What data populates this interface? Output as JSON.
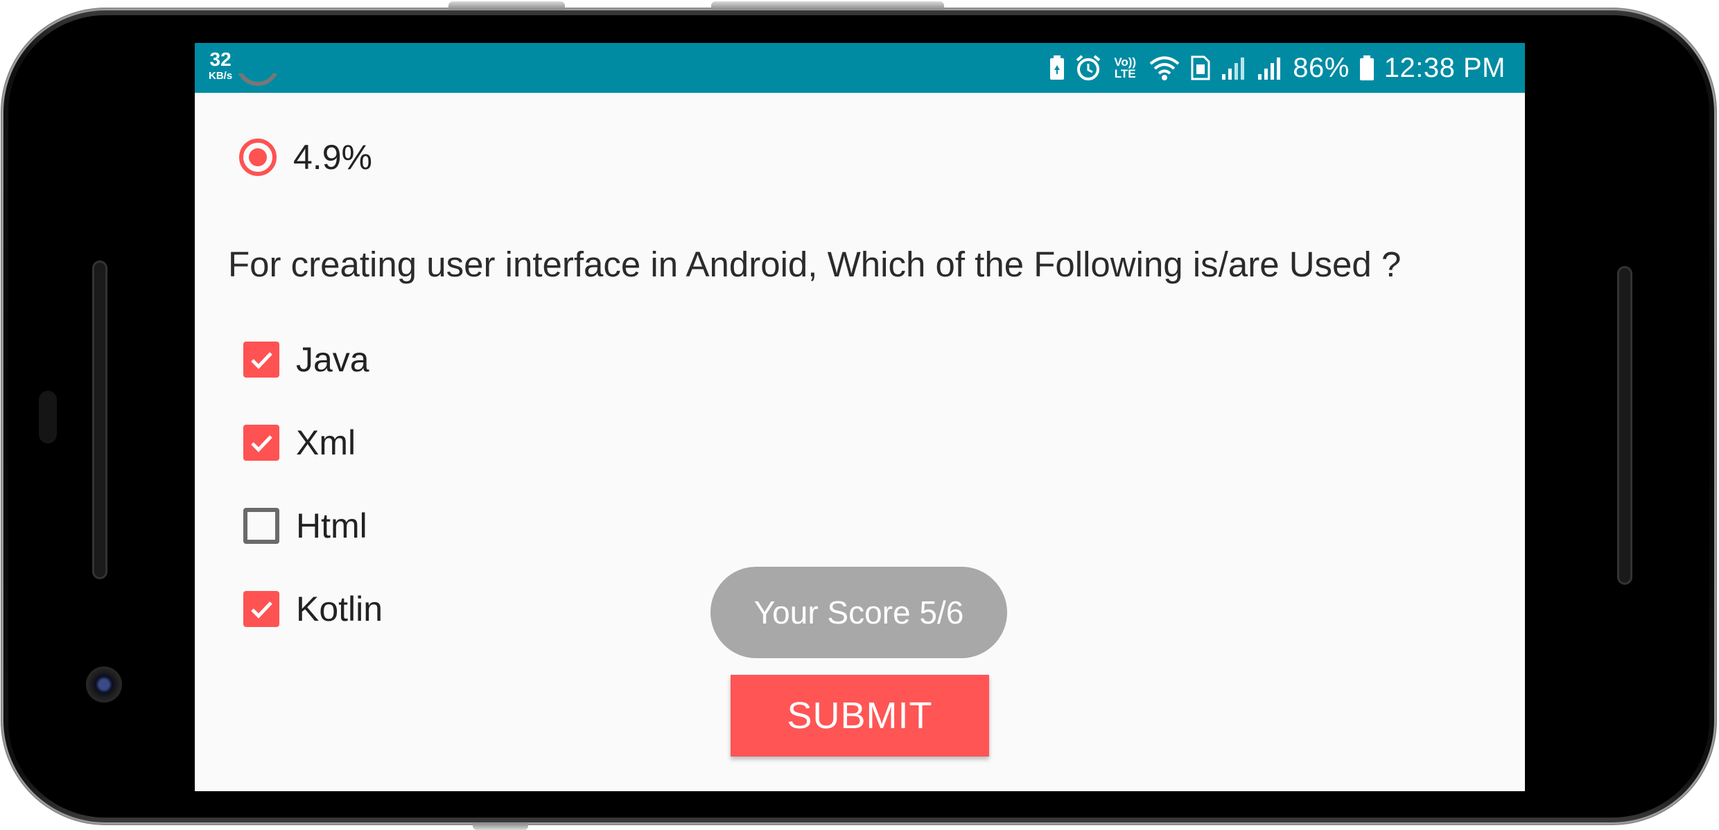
{
  "status_bar": {
    "net_speed_value": "32",
    "net_speed_unit": "KB/s",
    "volte_label": "Vo)) LTE",
    "battery_percent": "86%",
    "time": "12:38 PM",
    "icons": [
      "battery-saver-icon",
      "alarm-icon",
      "volte-icon",
      "wifi-icon",
      "sim-icon",
      "signal-icon",
      "signal-icon",
      "battery-icon"
    ],
    "color": "#008ba3"
  },
  "prev_question": {
    "selected_option": "4.9%"
  },
  "question": {
    "text": "For creating user interface in Android, Which of the Following is/are Used ?",
    "options": [
      {
        "label": "Java",
        "checked": true
      },
      {
        "label": "Xml",
        "checked": true
      },
      {
        "label": "Html",
        "checked": false
      },
      {
        "label": "Kotlin",
        "checked": true
      }
    ]
  },
  "score_toast": "Your Score 5/6",
  "submit_label": "SUBMIT",
  "colors": {
    "accent": "#ff5252",
    "toast": "#a8a8a8",
    "screen_bg": "#fafafa"
  }
}
